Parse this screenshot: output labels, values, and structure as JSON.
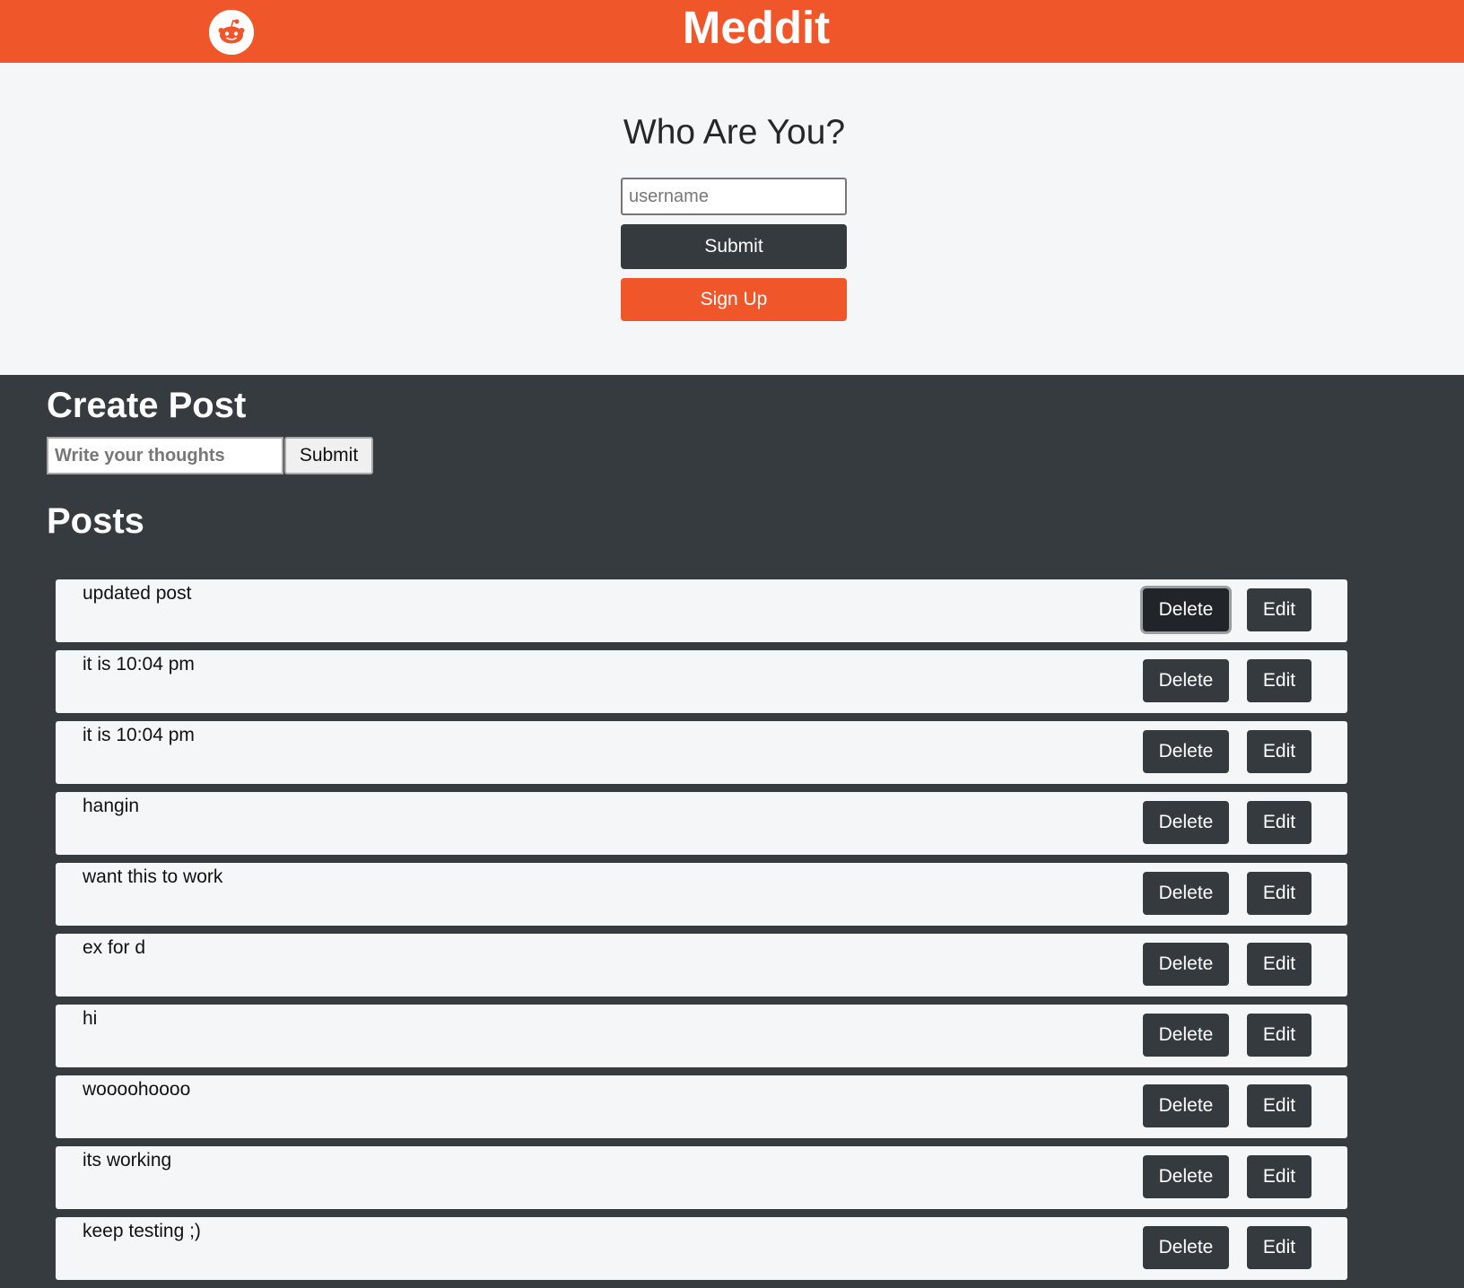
{
  "header": {
    "title": "Meddit",
    "logo_icon": "reddit-alien-icon",
    "brand_color": "#ef572b"
  },
  "login": {
    "title": "Who Are You?",
    "username_placeholder": "username",
    "submit_label": "Submit",
    "signup_label": "Sign Up"
  },
  "create_post": {
    "title": "Create Post",
    "input_placeholder": "Write your thoughts",
    "submit_label": "Submit"
  },
  "posts": {
    "title": "Posts",
    "delete_label": "Delete",
    "edit_label": "Edit",
    "items": [
      {
        "text": "updated post",
        "delete_focused": true
      },
      {
        "text": "it is 10:04 pm"
      },
      {
        "text": "it is 10:04 pm"
      },
      {
        "text": "hangin"
      },
      {
        "text": "want this to work"
      },
      {
        "text": "ex for d"
      },
      {
        "text": "hi"
      },
      {
        "text": "woooohoooo"
      },
      {
        "text": "its working"
      },
      {
        "text": "keep testing ;)"
      }
    ]
  }
}
